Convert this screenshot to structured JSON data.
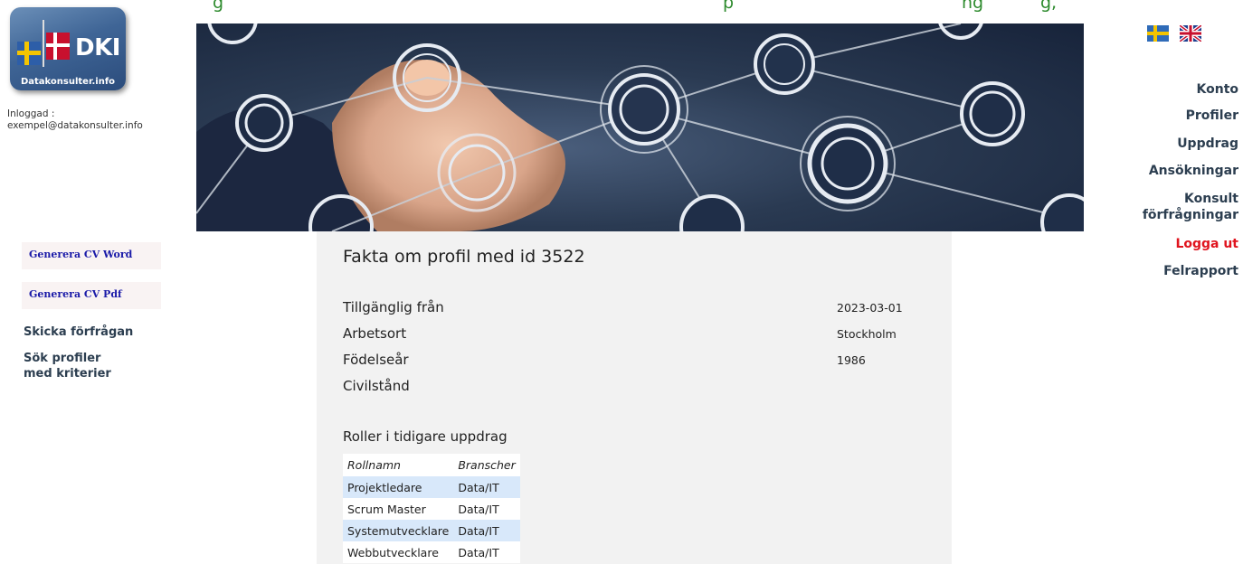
{
  "marquee": {
    "left": "g",
    "right": "p",
    "right2": "ng",
    "right3": "g,"
  },
  "logo": {
    "text": "DKI",
    "caption": "Datakonsulter.info"
  },
  "login": {
    "label": "Inloggad :",
    "email": "exempel@datakonsulter.info"
  },
  "left_menu": {
    "generate_word": "Generera CV Word",
    "generate_pdf": "Generera CV Pdf",
    "send_request": "Skicka förfrågan",
    "search_profiles": "Sök profiler med kriterier"
  },
  "profile": {
    "title": "Fakta om profil med id 3522",
    "facts": [
      {
        "label": "Tillgänglig från",
        "value": "2023-03-01"
      },
      {
        "label": "Arbetsort",
        "value": "Stockholm"
      },
      {
        "label": "Födelseår",
        "value": "1986"
      },
      {
        "label": "Civilstånd",
        "value": ""
      }
    ],
    "roles_heading": "Roller i tidigare uppdrag",
    "roles_columns": [
      "Rollnamn",
      "Branscher"
    ],
    "roles": [
      {
        "role": "Projektledare",
        "industry": "Data/IT"
      },
      {
        "role": "Scrum Master",
        "industry": "Data/IT"
      },
      {
        "role": "Systemutvecklare",
        "industry": "Data/IT"
      },
      {
        "role": "Webbutvecklare",
        "industry": "Data/IT"
      }
    ]
  },
  "right_nav": {
    "konto": "Konto",
    "profiler": "Profiler",
    "uppdrag": "Uppdrag",
    "ansokningar": "Ansökningar",
    "konsult": "Konsult förfrågningar",
    "logout": "Logga ut",
    "felrapport": "Felrapport"
  },
  "languages": [
    "swedish-flag-icon",
    "uk-flag-icon"
  ],
  "colors": {
    "logout": "#e0141e",
    "row_highlight": "#d8e8fa",
    "menu_text": "#2c3e50"
  }
}
